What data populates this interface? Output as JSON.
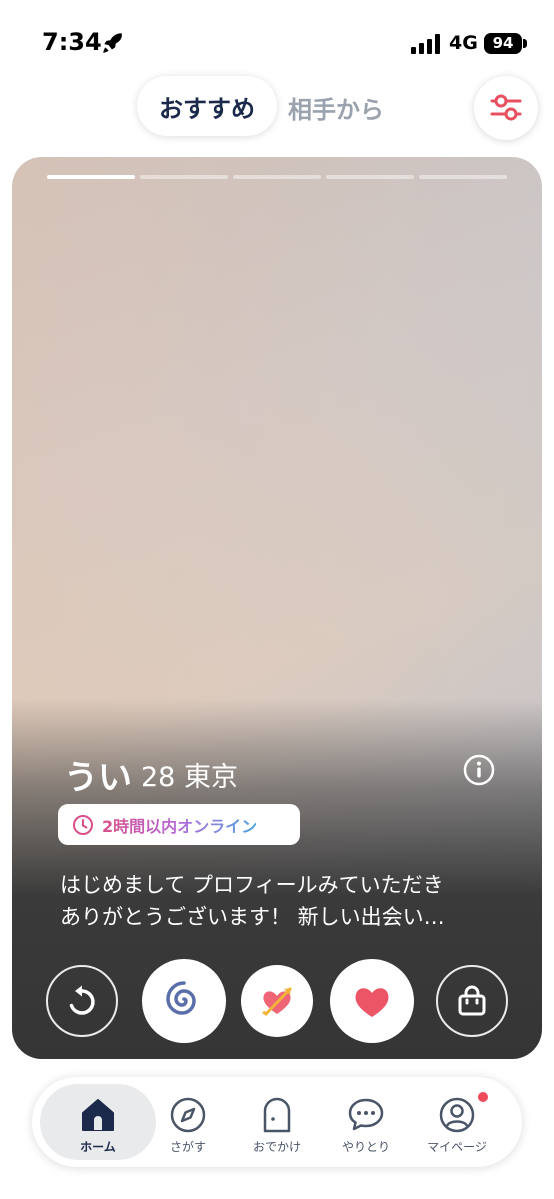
{
  "status_bar": {
    "time": "7:34",
    "network": "4G",
    "battery": "94"
  },
  "header": {
    "tabs": [
      {
        "label": "おすすめ",
        "selected": true
      },
      {
        "label": "相手から",
        "selected": false
      }
    ],
    "filter_icon": "sliders-icon"
  },
  "card": {
    "photo_count": 5,
    "current_photo": 1,
    "name": "うい",
    "age": "28",
    "location": "東京",
    "online_status": "2時間以内オンライン",
    "bio_line1": "はじめまして プロフィールみていただき",
    "bio_line2": "ありがとうございます！ 新しい出会い…"
  },
  "actions": [
    {
      "name": "undo",
      "icon": "undo-icon"
    },
    {
      "name": "skip",
      "icon": "spiral-icon"
    },
    {
      "name": "super-like",
      "icon": "heart-arrow-icon"
    },
    {
      "name": "like",
      "icon": "heart-icon"
    },
    {
      "name": "shop",
      "icon": "shopping-bag-icon"
    }
  ],
  "colors": {
    "accent": "#e8505f",
    "navy": "#1b2a4a"
  },
  "bottom_nav": {
    "items": [
      {
        "label": "ホーム",
        "icon": "home-icon",
        "active": true
      },
      {
        "label": "さがす",
        "icon": "compass-icon",
        "active": false
      },
      {
        "label": "おでかけ",
        "icon": "door-icon",
        "active": false
      },
      {
        "label": "やりとり",
        "icon": "chat-icon",
        "active": false
      },
      {
        "label": "マイページ",
        "icon": "profile-icon",
        "active": false,
        "has_notification": true
      }
    ]
  }
}
